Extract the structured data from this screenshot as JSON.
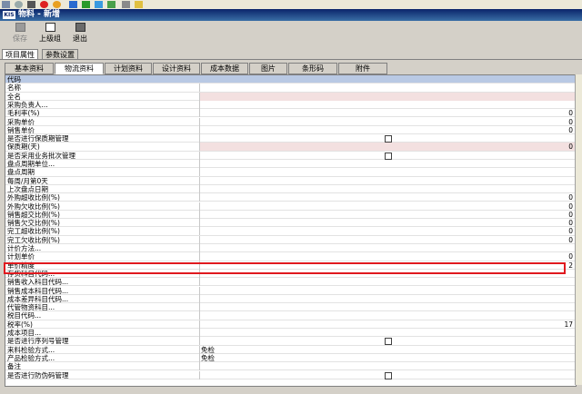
{
  "window": {
    "logo": "KIS",
    "title": "物料 - 新增"
  },
  "toolbar": {
    "save": "保存",
    "parent_group": "上级组",
    "exit": "退出"
  },
  "subtabs": [
    "项目属性",
    "参数设置"
  ],
  "tabs": [
    "基本资料",
    "物流资料",
    "计划资料",
    "设计资料",
    "成本数据",
    "图片",
    "条形码",
    "附件"
  ],
  "rows": [
    {
      "label": "代码",
      "value": ""
    },
    {
      "label": "名称",
      "value": ""
    },
    {
      "label": "全名",
      "value": ""
    },
    {
      "label": "采购负责人...",
      "value": ""
    },
    {
      "label": "毛利率(%)",
      "value": "0"
    },
    {
      "label": "采购单价",
      "value": "0"
    },
    {
      "label": "销售单价",
      "value": "0"
    },
    {
      "label": "是否进行保质期管理",
      "value": ""
    },
    {
      "label": "保质期(天)",
      "value": "0"
    },
    {
      "label": "是否采用业务批次管理",
      "value": ""
    },
    {
      "label": "盘点周期单位...",
      "value": ""
    },
    {
      "label": "盘点周期",
      "value": ""
    },
    {
      "label": "每周/月第0天",
      "value": ""
    },
    {
      "label": "上次盘点日期",
      "value": ""
    },
    {
      "label": "外购超收比例(%)",
      "value": "0"
    },
    {
      "label": "外购欠收比例(%)",
      "value": "0"
    },
    {
      "label": "销售超交比例(%)",
      "value": "0"
    },
    {
      "label": "销售欠交比例(%)",
      "value": "0"
    },
    {
      "label": "完工超收比例(%)",
      "value": "0"
    },
    {
      "label": "完工欠收比例(%)",
      "value": "0"
    },
    {
      "label": "计价方法...",
      "value": ""
    },
    {
      "label": "计划单价",
      "value": "0"
    },
    {
      "label": "单价精度",
      "value": "2"
    },
    {
      "label": "存货科目代码...",
      "value": ""
    },
    {
      "label": "销售收入科目代码...",
      "value": ""
    },
    {
      "label": "销售成本科目代码...",
      "value": ""
    },
    {
      "label": "成本差异科目代码...",
      "value": ""
    },
    {
      "label": "代管物资科目...",
      "value": ""
    },
    {
      "label": "税目代码...",
      "value": ""
    },
    {
      "label": "税率(%)",
      "value": "17"
    },
    {
      "label": "成本项目...",
      "value": ""
    },
    {
      "label": "是否进行序列号管理",
      "value": ""
    },
    {
      "label": "来料检验方式...",
      "value": "免检"
    },
    {
      "label": "产品检验方式...",
      "value": "免检"
    },
    {
      "label": "备注",
      "value": ""
    },
    {
      "label": "是否进行防伪码管理",
      "value": ""
    }
  ],
  "colors": {
    "header_row": "#b9c9e4",
    "required_row": "#f3e0e0",
    "highlight": "#e0191e"
  }
}
